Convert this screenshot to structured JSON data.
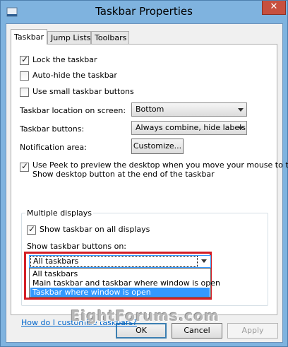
{
  "window": {
    "title": "Taskbar Properties",
    "close_glyph": "✕"
  },
  "tabs": [
    {
      "label": "Taskbar",
      "active": true
    },
    {
      "label": "Jump Lists",
      "active": false
    },
    {
      "label": "Toolbars",
      "active": false
    }
  ],
  "options": {
    "lock_taskbar": {
      "label": "Lock the taskbar",
      "checked": true
    },
    "auto_hide": {
      "label": "Auto-hide the taskbar",
      "checked": false
    },
    "small_buttons": {
      "label": "Use small taskbar buttons",
      "checked": false
    }
  },
  "location": {
    "label": "Taskbar location on screen:",
    "value": "Bottom"
  },
  "buttons_setting": {
    "label": "Taskbar buttons:",
    "value": "Always combine, hide labels"
  },
  "notification": {
    "label": "Notification area:",
    "button": "Customize..."
  },
  "peek": {
    "line1": "Use Peek to preview the desktop when you move your mouse to the",
    "line2": "Show desktop button at the end of the taskbar",
    "checked": true
  },
  "multiple_displays": {
    "group_label": "Multiple displays",
    "show_all": {
      "label": "Show taskbar on all displays",
      "checked": true
    },
    "buttons_on_label": "Show taskbar buttons on:",
    "selected": "All taskbars",
    "options": [
      "All taskbars",
      "Main taskbar and taskbar where window is open",
      "Taskbar where window is open"
    ],
    "highlighted_index": 2
  },
  "help_link": "How do I customize taskbars?",
  "watermark": "EightForums.com",
  "footer": {
    "ok": "OK",
    "cancel": "Cancel",
    "apply": "Apply"
  }
}
